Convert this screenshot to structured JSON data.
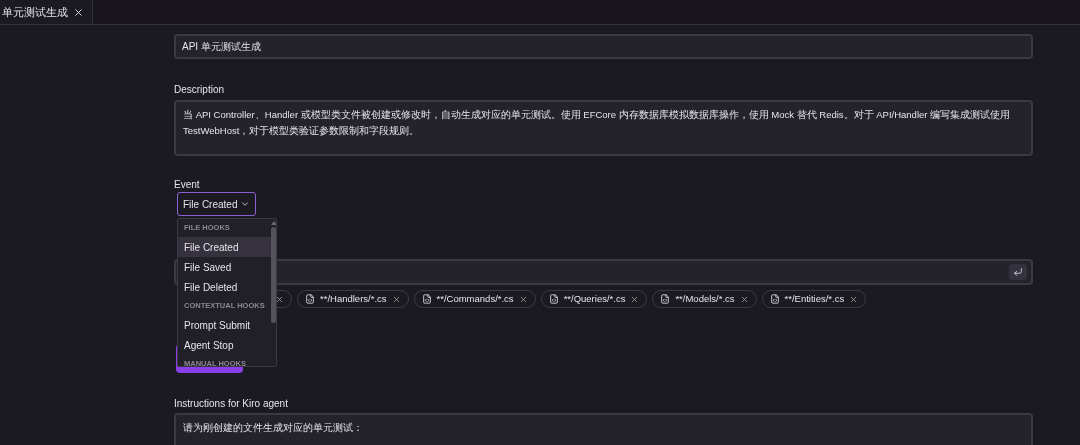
{
  "tabs": [
    {
      "label": "单元测试生成"
    }
  ],
  "name_field": {
    "value": "API 单元测试生成"
  },
  "description": {
    "label": "Description",
    "value": "当 API Controller、Handler 或模型类文件被创建或修改时，自动生成对应的单元测试。使用 EFCore 内存数据库模拟数据库操作，使用 Mock 替代 Redis。对于 API/Handler 编写集成测试使用 TestWebHost，对于模型类验证参数限制和字段规则。"
  },
  "event": {
    "label": "Event",
    "value": "File Created",
    "menu": [
      {
        "kind": "header",
        "label": "FILE HOOKS"
      },
      {
        "kind": "item",
        "label": "File Created",
        "selected": true
      },
      {
        "kind": "item",
        "label": "File Saved",
        "selected": false
      },
      {
        "kind": "item",
        "label": "File Deleted",
        "selected": false
      },
      {
        "kind": "header",
        "label": "CONTEXTUAL HOOKS"
      },
      {
        "kind": "item",
        "label": "Prompt Submit",
        "selected": false
      },
      {
        "kind": "item",
        "label": "Agent Stop",
        "selected": false
      },
      {
        "kind": "header",
        "label": "MANUAL HOOKS"
      }
    ]
  },
  "patterns": {
    "chips": [
      {
        "label": "**/Handlers/*.cs"
      },
      {
        "label": "**/Commands/*.cs"
      },
      {
        "label": "**/Queries/*.cs"
      },
      {
        "label": "**/Models/*.cs"
      },
      {
        "label": "**/Entities/*.cs"
      }
    ]
  },
  "instructions": {
    "label": "Instructions for Kiro agent",
    "value": "请为刚创建的文件生成对应的单元测试："
  }
}
